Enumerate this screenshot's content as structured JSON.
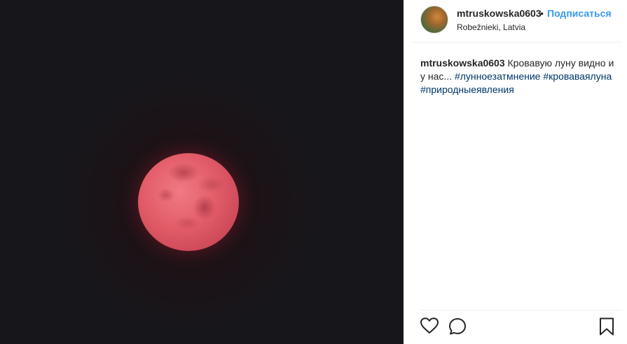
{
  "post": {
    "username": "mtruskowska0603",
    "separator": "•",
    "follow_label": "Подписаться",
    "location": "Robežnieki, Latvia"
  },
  "caption": {
    "username": "mtruskowska0603",
    "text": " Кровавую луну видно и у нас... ",
    "hashtags": [
      "#лунноезатмнение",
      "#кроваваялуна",
      "#природныеявления"
    ]
  },
  "icons": {
    "like": "heart-icon",
    "comment": "comment-icon",
    "save": "bookmark-icon"
  },
  "colors": {
    "link": "#3897f0",
    "hashtag": "#003569",
    "moon": "#e25c68",
    "sky": "#17171b"
  }
}
